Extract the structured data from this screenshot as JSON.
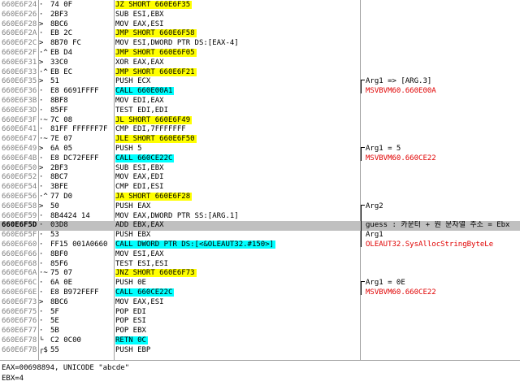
{
  "rows": [
    {
      "addr": "660E6F24",
      "mark": "· ",
      "arrow": "~",
      "bytes": "74 0F",
      "instr": "JZ SHORT 660E6F35",
      "hl": "jmp",
      "comment": ""
    },
    {
      "addr": "660E6F26",
      "mark": "· ",
      "arrow": "",
      "bytes": "2BF3",
      "instr": "SUB ESI,EBX",
      "hl": "",
      "comment": ""
    },
    {
      "addr": "660E6F28",
      "mark": "> ",
      "arrow": "",
      "bytes": "8BC6",
      "instr": "MOV EAX,ESI",
      "hl": "",
      "comment": ""
    },
    {
      "addr": "660E6F2A",
      "mark": "· ",
      "arrow": "",
      "bytes": "EB 2C",
      "instr": "JMP SHORT 660E6F58",
      "hl": "jmp",
      "comment": ""
    },
    {
      "addr": "660E6F2C",
      "mark": "> ",
      "arrow": "",
      "bytes": "8B70 FC",
      "instr": "MOV ESI,DWORD PTR DS:[EAX-4]",
      "hl": "",
      "comment": ""
    },
    {
      "addr": "660E6F2F",
      "mark": "·^",
      "arrow": "",
      "bytes": "EB D4",
      "instr": "JMP SHORT 660E6F05",
      "hl": "jmp",
      "comment": ""
    },
    {
      "addr": "660E6F31",
      "mark": "> ",
      "arrow": "",
      "bytes": "33C0",
      "instr": "XOR EAX,EAX",
      "hl": "",
      "comment": ""
    },
    {
      "addr": "660E6F33",
      "mark": "·^",
      "arrow": "",
      "bytes": "EB EC",
      "instr": "JMP SHORT 660E6F21",
      "hl": "jmp",
      "comment": ""
    },
    {
      "addr": "660E6F35",
      "mark": "> ",
      "arrow": "",
      "bytes": "51",
      "instr": "PUSH ECX",
      "hl": "",
      "comment": "Arg1 => [ARG.3]"
    },
    {
      "addr": "660E6F36",
      "mark": "· ",
      "arrow": "",
      "bytes": "E8 6691FFFF",
      "instr": "CALL 660E00A1",
      "hl": "call",
      "comment": "MSVBVM60.660E00A"
    },
    {
      "addr": "660E6F3B",
      "mark": "· ",
      "arrow": "",
      "bytes": "8BF8",
      "instr": "MOV EDI,EAX",
      "hl": "",
      "comment": ""
    },
    {
      "addr": "660E6F3D",
      "mark": "· ",
      "arrow": "",
      "bytes": "85FF",
      "instr": "TEST EDI,EDI",
      "hl": "",
      "comment": ""
    },
    {
      "addr": "660E6F3F",
      "mark": "·~",
      "arrow": "",
      "bytes": "7C 08",
      "instr": "JL SHORT 660E6F49",
      "hl": "jmp",
      "comment": ""
    },
    {
      "addr": "660E6F41",
      "mark": "· ",
      "arrow": "",
      "bytes": "81FF FFFFFF7F",
      "instr": "CMP EDI,7FFFFFFF",
      "hl": "",
      "comment": ""
    },
    {
      "addr": "660E6F47",
      "mark": "·~",
      "arrow": "",
      "bytes": "7E 07",
      "instr": "JLE SHORT 660E6F50",
      "hl": "jmp",
      "comment": ""
    },
    {
      "addr": "660E6F49",
      "mark": "> ",
      "arrow": "",
      "bytes": "6A 05",
      "instr": "PUSH 5",
      "hl": "",
      "comment": "Arg1 = 5"
    },
    {
      "addr": "660E6F4B",
      "mark": "· ",
      "arrow": "",
      "bytes": "E8 DC72FEFF",
      "instr": "CALL 660CE22C",
      "hl": "call",
      "comment": "MSVBVM60.660CE22"
    },
    {
      "addr": "660E6F50",
      "mark": "> ",
      "arrow": "",
      "bytes": "2BF3",
      "instr": "SUB ESI,EBX",
      "hl": "",
      "comment": ""
    },
    {
      "addr": "660E6F52",
      "mark": "· ",
      "arrow": "",
      "bytes": "8BC7",
      "instr": "MOV EAX,EDI",
      "hl": "",
      "comment": ""
    },
    {
      "addr": "660E6F54",
      "mark": "· ",
      "arrow": "",
      "bytes": "3BFE",
      "instr": "CMP EDI,ESI",
      "hl": "",
      "comment": ""
    },
    {
      "addr": "660E6F56",
      "mark": "·^",
      "arrow": "",
      "bytes": "77 D0",
      "instr": "JA SHORT 660E6F28",
      "hl": "jmp",
      "comment": ""
    },
    {
      "addr": "660E6F58",
      "mark": "> ",
      "arrow": "",
      "bytes": "50",
      "instr": "PUSH EAX",
      "hl": "",
      "comment": "Arg2"
    },
    {
      "addr": "660E6F59",
      "mark": "· ",
      "arrow": "",
      "bytes": "8B4424 14",
      "instr": "MOV EAX,DWORD PTR SS:[ARG.1]",
      "hl": "",
      "comment": ""
    },
    {
      "addr": "660E6F5D",
      "mark": "· ",
      "arrow": "",
      "bytes": "03D8",
      "instr": "ADD EBX,EAX",
      "hl": "",
      "comment": "guess : 카운터 + 원 문자열 주소 = Ebx",
      "selected": true
    },
    {
      "addr": "660E6F5F",
      "mark": "· ",
      "arrow": "",
      "bytes": "53",
      "instr": "PUSH EBX",
      "hl": "",
      "comment": "Arg1"
    },
    {
      "addr": "660E6F60",
      "mark": "· ",
      "arrow": "",
      "bytes": "FF15 001A0660",
      "instr": "CALL DWORD PTR DS:[<&OLEAUT32.#150>]",
      "hl": "call",
      "comment": "OLEAUT32.SysAllocStringByteLe"
    },
    {
      "addr": "660E6F66",
      "mark": "· ",
      "arrow": "",
      "bytes": "8BF0",
      "instr": "MOV ESI,EAX",
      "hl": "",
      "comment": ""
    },
    {
      "addr": "660E6F68",
      "mark": "· ",
      "arrow": "",
      "bytes": "85F6",
      "instr": "TEST ESI,ESI",
      "hl": "",
      "comment": ""
    },
    {
      "addr": "660E6F6A",
      "mark": "·~",
      "arrow": "",
      "bytes": "75 07",
      "instr": "JNZ SHORT 660E6F73",
      "hl": "jmp",
      "comment": ""
    },
    {
      "addr": "660E6F6C",
      "mark": "· ",
      "arrow": "",
      "bytes": "6A 0E",
      "instr": "PUSH 0E",
      "hl": "",
      "comment": "Arg1 = 0E"
    },
    {
      "addr": "660E6F6E",
      "mark": "· ",
      "arrow": "",
      "bytes": "E8 B972FEFF",
      "instr": "CALL 660CE22C",
      "hl": "call",
      "comment": "MSVBVM60.660CE22"
    },
    {
      "addr": "660E6F73",
      "mark": "> ",
      "arrow": "",
      "bytes": "8BC6",
      "instr": "MOV EAX,ESI",
      "hl": "",
      "comment": ""
    },
    {
      "addr": "660E6F75",
      "mark": "· ",
      "arrow": "",
      "bytes": "5F",
      "instr": "POP EDI",
      "hl": "",
      "comment": ""
    },
    {
      "addr": "660E6F76",
      "mark": "· ",
      "arrow": "",
      "bytes": "5E",
      "instr": "POP ESI",
      "hl": "",
      "comment": ""
    },
    {
      "addr": "660E6F77",
      "mark": "· ",
      "arrow": "",
      "bytes": "5B",
      "instr": "POP EBX",
      "hl": "",
      "comment": ""
    },
    {
      "addr": "660E6F78",
      "mark": "└ ",
      "arrow": "",
      "bytes": "C2 0C00",
      "instr": "RETN 0C",
      "hl": "call",
      "comment": ""
    },
    {
      "addr": "660E6F7B",
      "mark": "┌$",
      "arrow": "",
      "bytes": "55",
      "instr": "PUSH EBP",
      "hl": "",
      "comment": ""
    }
  ],
  "status": {
    "line1": "EAX=00698894, UNICODE \"abcde\"",
    "line2": "EBX=4"
  }
}
